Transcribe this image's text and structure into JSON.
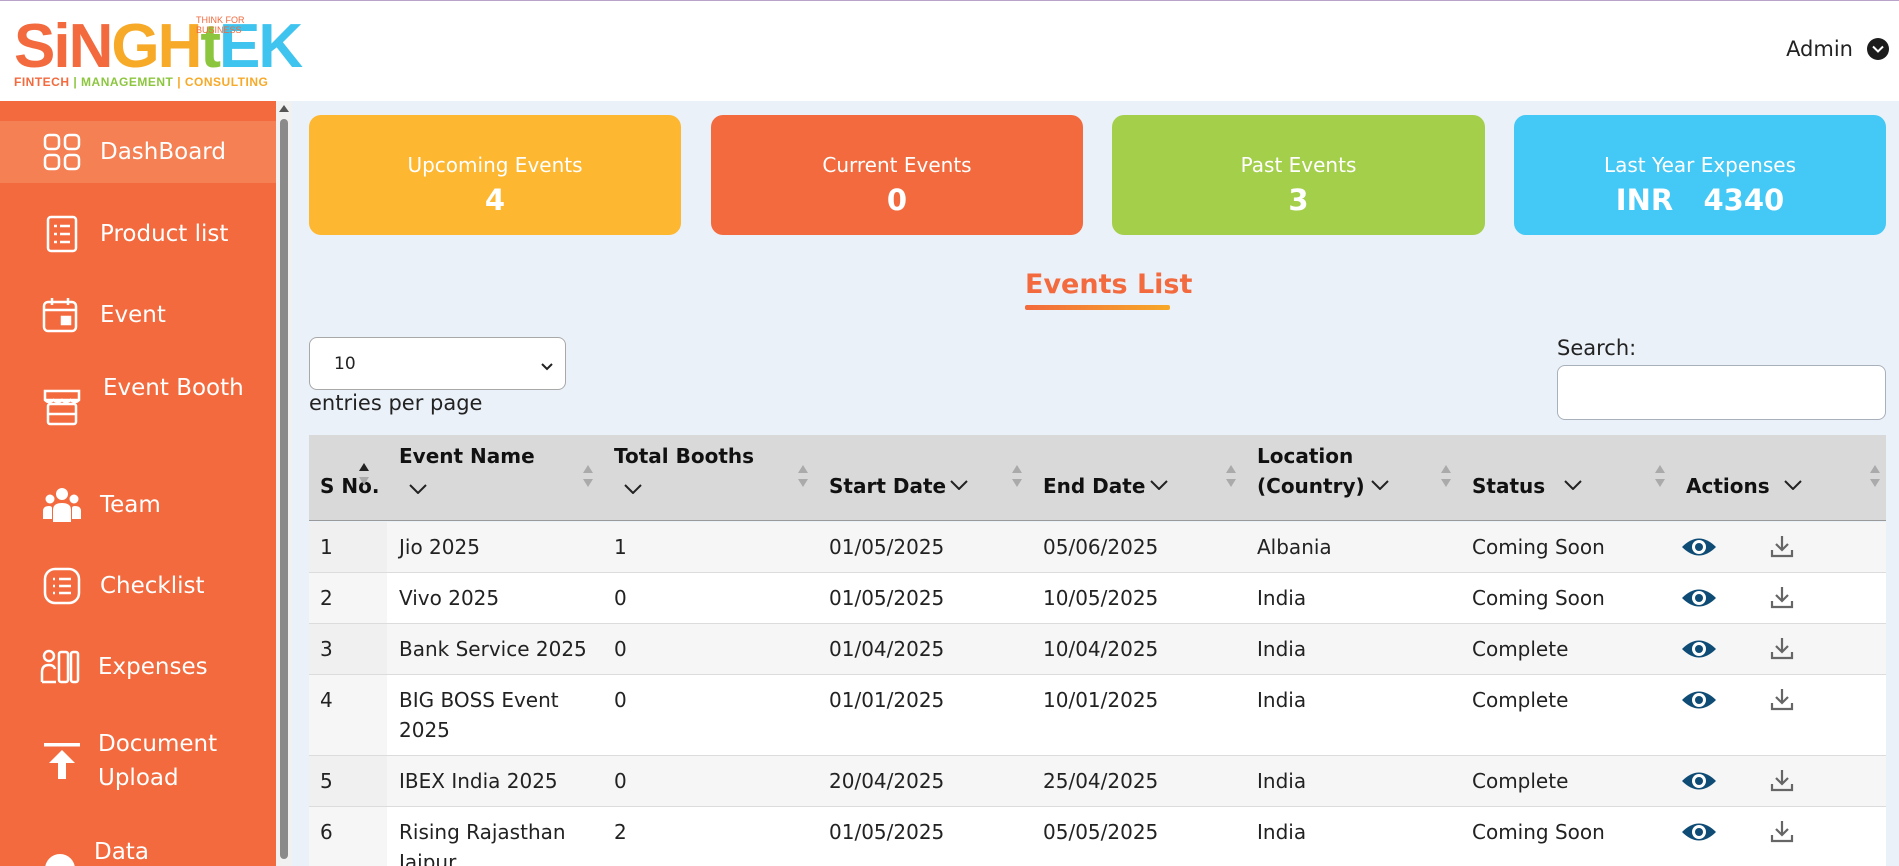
{
  "brand": {
    "logo_main_1": "SiN",
    "logo_main_2": "GH",
    "logo_main_3": "t",
    "logo_main_4": "EK",
    "tagline": "THINK FOR BUSINESS",
    "sub_1": "FINTECH",
    "sub_2": "MANAGEMENT",
    "sub_3": "CONSULTING",
    "colors": {
      "orange": "#f26a3d",
      "yellow": "#f7a928",
      "green": "#8cc63f",
      "blue": "#3ec4ef"
    }
  },
  "header": {
    "user_label": "Admin"
  },
  "sidebar": {
    "items": [
      {
        "label": "DashBoard",
        "icon": "dashboard-grid-icon",
        "active": true
      },
      {
        "label": "Product list",
        "icon": "list-document-icon"
      },
      {
        "label": "Event",
        "icon": "calendar-icon"
      },
      {
        "label": "Event Booth",
        "icon": "booth-store-icon"
      },
      {
        "label": "Team",
        "icon": "team-users-icon"
      },
      {
        "label": "Checklist",
        "icon": "checklist-icon"
      },
      {
        "label": "Expenses",
        "icon": "expenses-icon"
      },
      {
        "label": "Document Upload",
        "icon": "upload-icon"
      },
      {
        "label": "Data",
        "icon": "data-icon"
      }
    ]
  },
  "cards": [
    {
      "title": "Upcoming Events",
      "value": "4",
      "color": "#fdb730"
    },
    {
      "title": "Current Events",
      "value": "0",
      "color": "#f26a3d"
    },
    {
      "title": "Past Events",
      "value": "3",
      "color": "#a3cf4b"
    },
    {
      "title": "Last Year Expenses",
      "value": "INR   4340",
      "color": "#44c8f5"
    }
  ],
  "events_list": {
    "title": "Events List",
    "entries_value": "10",
    "entries_label": "entries per page",
    "search_label": "Search:",
    "search_value": "",
    "columns": {
      "sno": "S No.",
      "event_name": "Event Name",
      "total_booths": "Total Booths",
      "start_date": "Start Date",
      "end_date": "End Date",
      "location_1": "Location",
      "location_2": "(Country)",
      "status": "Status",
      "actions": "Actions"
    },
    "rows": [
      {
        "sno": "1",
        "name_1": "Jio 2025",
        "name_2": "",
        "booths": "1",
        "start": "01/05/2025",
        "end": "05/06/2025",
        "location": "Albania",
        "status": "Coming Soon"
      },
      {
        "sno": "2",
        "name_1": "Vivo 2025",
        "name_2": "",
        "booths": "0",
        "start": "01/05/2025",
        "end": "10/05/2025",
        "location": "India",
        "status": "Coming Soon"
      },
      {
        "sno": "3",
        "name_1": "Bank Service 2025",
        "name_2": "",
        "booths": "0",
        "start": "01/04/2025",
        "end": "10/04/2025",
        "location": "India",
        "status": "Complete"
      },
      {
        "sno": "4",
        "name_1": "BIG BOSS Event",
        "name_2": "2025",
        "booths": "0",
        "start": "01/01/2025",
        "end": "10/01/2025",
        "location": "India",
        "status": "Complete"
      },
      {
        "sno": "5",
        "name_1": "IBEX India 2025",
        "name_2": "",
        "booths": "0",
        "start": "20/04/2025",
        "end": "25/04/2025",
        "location": "India",
        "status": "Complete"
      },
      {
        "sno": "6",
        "name_1": "Rising Rajasthan",
        "name_2": "Jaipur",
        "booths": "2",
        "start": "01/05/2025",
        "end": "05/05/2025",
        "location": "India",
        "status": "Coming Soon"
      }
    ]
  }
}
